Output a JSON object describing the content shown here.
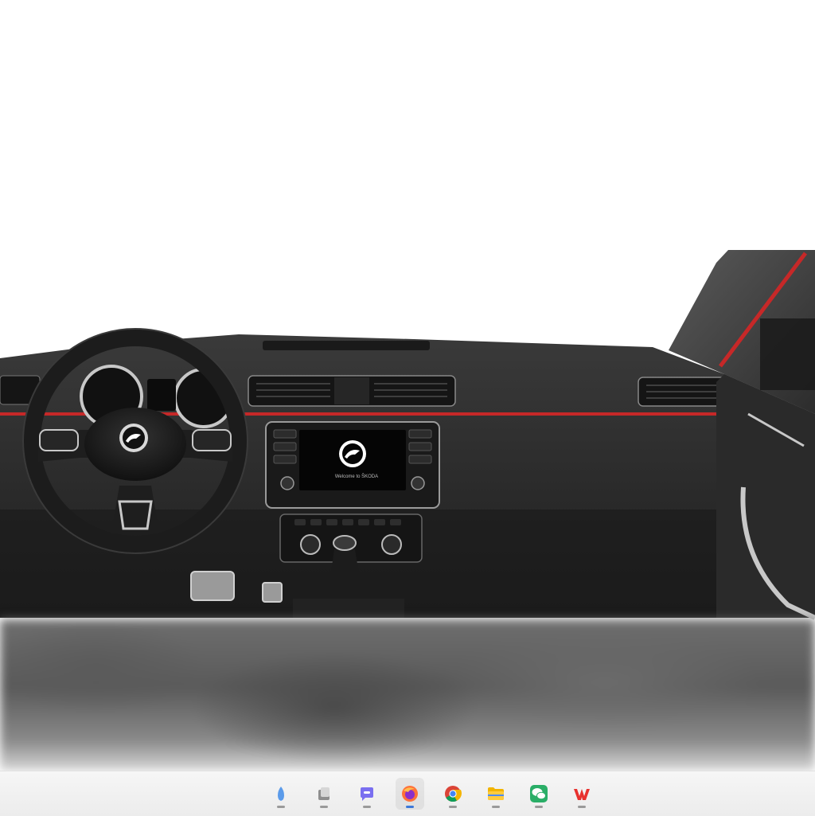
{
  "scene": {
    "infotainment_welcome_text": "Welcome to ŠKODA",
    "brand_logo_icon": "skoda-logo-icon",
    "colors": {
      "dashboard": "#2a2a2a",
      "accent_stripe": "#c62828",
      "trim_silver": "#c8c8c8",
      "background": "#ffffff"
    }
  },
  "taskbar": {
    "items": [
      {
        "icon": "input-method-icon",
        "active": false
      },
      {
        "icon": "files-app-icon",
        "active": false
      },
      {
        "icon": "chat-bubble-icon",
        "active": false
      },
      {
        "icon": "firefox-icon",
        "active": true
      },
      {
        "icon": "chrome-icon",
        "active": false
      },
      {
        "icon": "folder-icon",
        "active": false
      },
      {
        "icon": "wechat-icon",
        "active": false
      },
      {
        "icon": "wps-icon",
        "active": false
      }
    ]
  }
}
